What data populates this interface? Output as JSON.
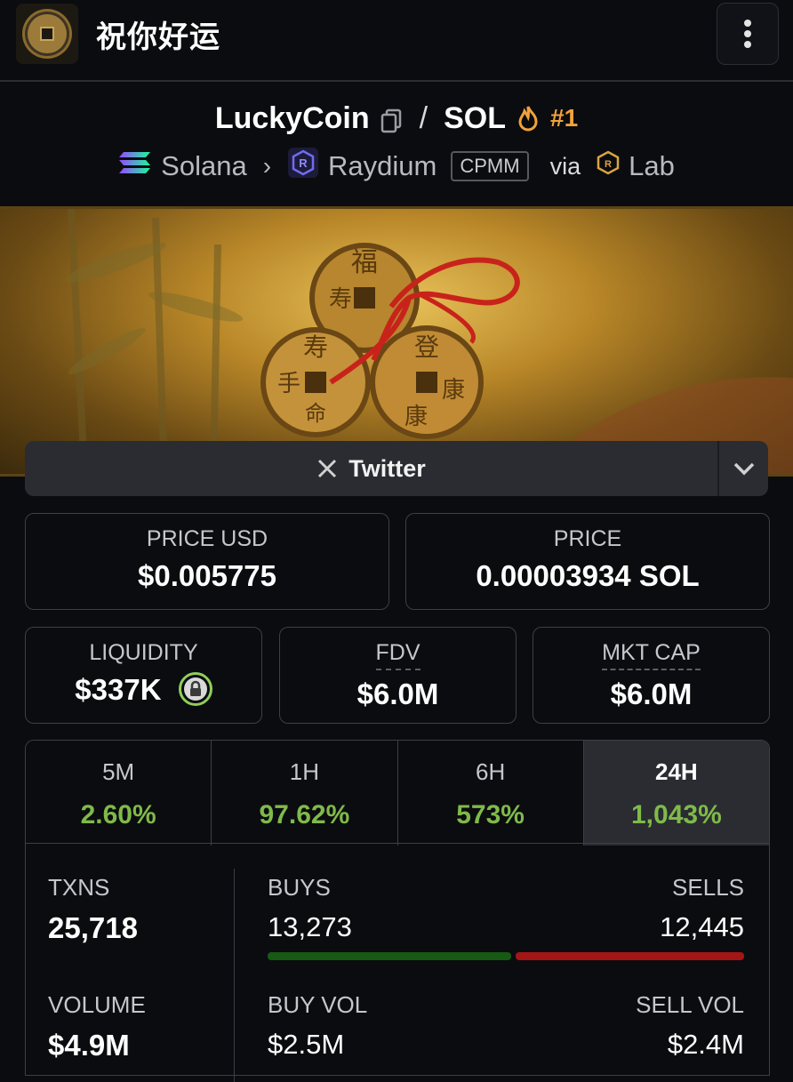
{
  "header": {
    "site_title": "祝你好运",
    "menu_icon": "kebab-menu-icon"
  },
  "pair": {
    "base": "LuckyCoin",
    "quote": "SOL",
    "separator": "/",
    "rank": "#1",
    "chain": "Solana",
    "dex": "Raydium",
    "pool_type": "CPMM",
    "via_label": "via",
    "via_source": "Lab"
  },
  "social": {
    "twitter_label": "Twitter"
  },
  "prices": {
    "price_usd_label": "PRICE USD",
    "price_usd": "$0.005775",
    "price_native_label": "PRICE",
    "price_native": "0.00003934 SOL",
    "liquidity_label": "LIQUIDITY",
    "liquidity": "$337K",
    "fdv_label": "FDV",
    "fdv": "$6.0M",
    "mktcap_label": "MKT CAP",
    "mktcap": "$6.0M"
  },
  "timeframes": [
    {
      "label": "5M",
      "change": "2.60%"
    },
    {
      "label": "1H",
      "change": "97.62%"
    },
    {
      "label": "6H",
      "change": "573%"
    },
    {
      "label": "24H",
      "change": "1,043%"
    }
  ],
  "stats": {
    "txns_label": "TXNS",
    "txns": "25,718",
    "buys_label": "BUYS",
    "buys": "13,273",
    "sells_label": "SELLS",
    "sells": "12,445",
    "volume_label": "VOLUME",
    "volume": "$4.9M",
    "buy_vol_label": "BUY VOL",
    "buy_vol": "$2.5M",
    "sell_vol_label": "SELL VOL",
    "sell_vol": "$2.4M"
  },
  "colors": {
    "positive": "#7fba4a",
    "buy_bar": "#165a14",
    "sell_bar": "#a41515",
    "rank": "#f0a23b"
  }
}
